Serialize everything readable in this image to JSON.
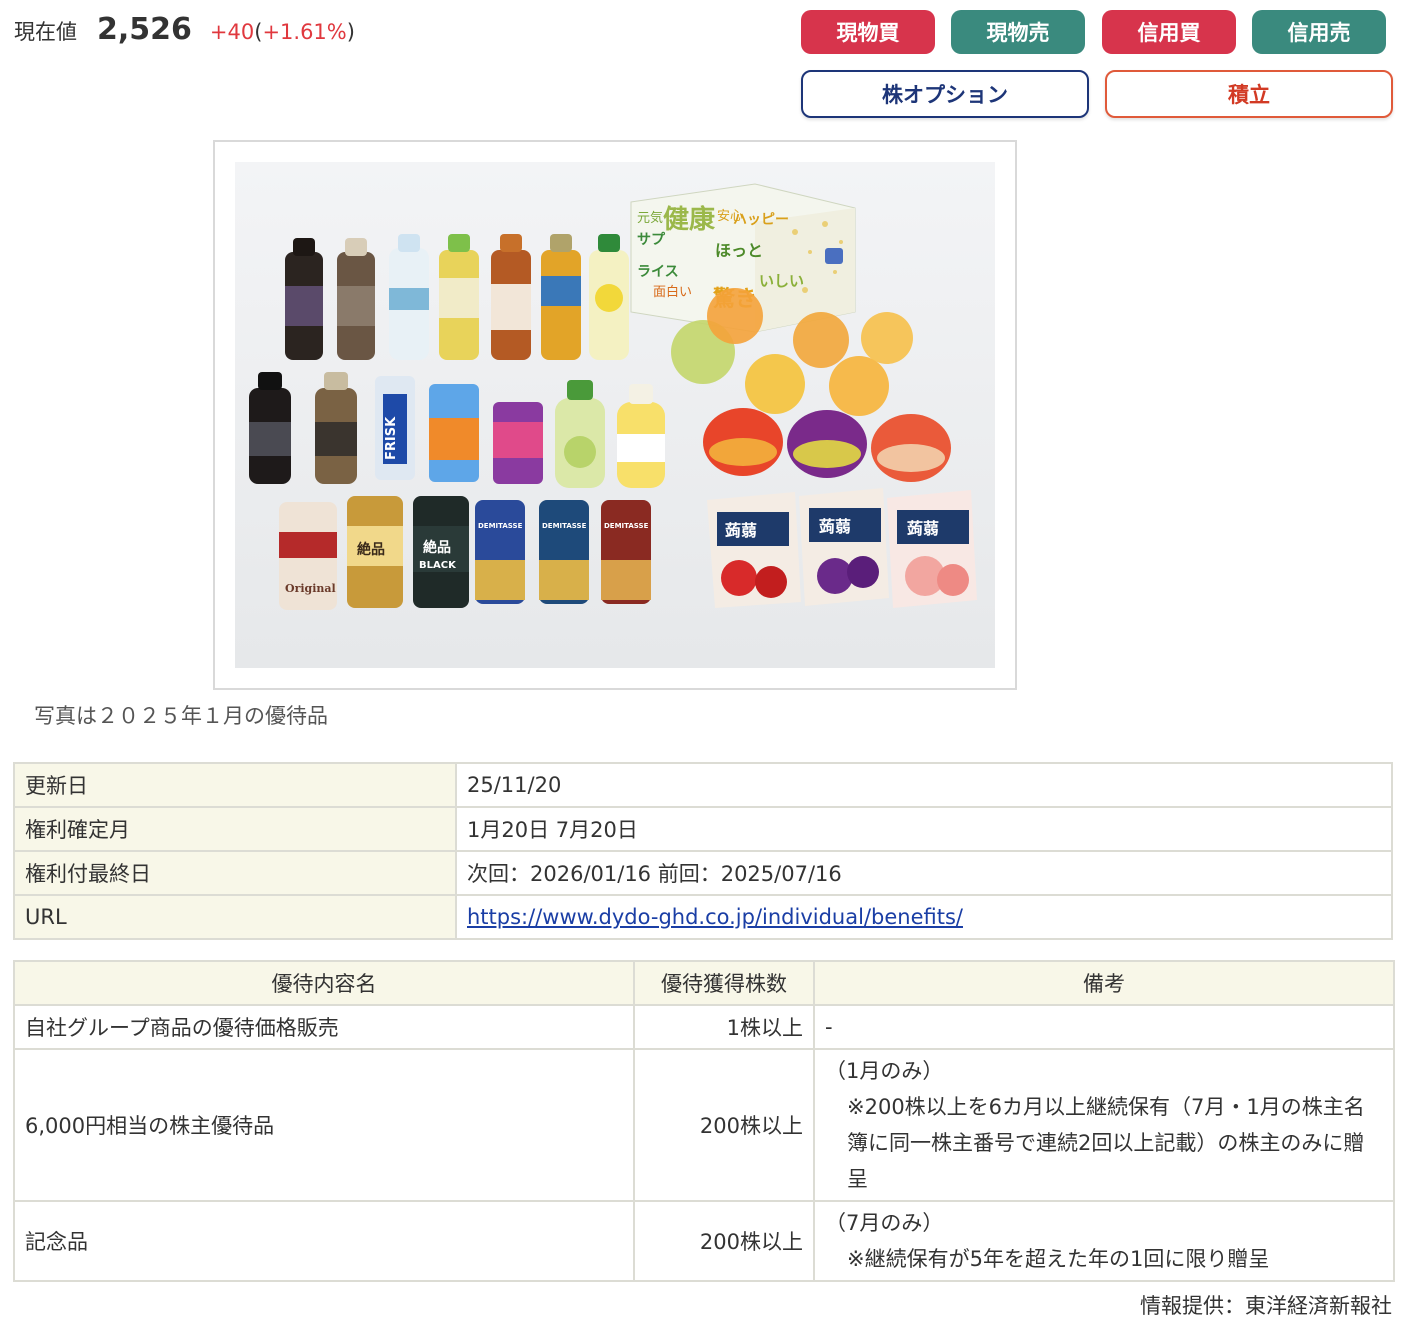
{
  "price": {
    "label": "現在値",
    "value": "2,526",
    "change": "+40",
    "paren_open": " (",
    "change_pct": "+1.61%",
    "paren_close": ")"
  },
  "buttons": {
    "genbutsu_buy": "現物買",
    "genbutsu_sell": "現物売",
    "shinyo_buy": "信用買",
    "shinyo_sell": "信用売",
    "option": "株オプション",
    "tsumitate": "積立"
  },
  "colors": {
    "buy": "#d7344c",
    "sell": "#3a8a7e",
    "option": "#1d3578",
    "tsumitate": "#d23a24",
    "up": "#e0383e"
  },
  "photo": {
    "box_text_1": "元気",
    "box_text_2": "健康",
    "box_text_3": "ハッピー",
    "box_text_4": "安心",
    "box_text_5": "ほっと",
    "box_text_6": "サプ",
    "box_text_7": "ライス",
    "box_text_8": "驚き",
    "box_text_9": "いしい",
    "box_text_10": "面白い",
    "can_text_1": "FRISK",
    "can_text_2": "絶品",
    "can_text_3": "BLACK",
    "can_text_4": "DEMITASSE",
    "can_text_5": "Original",
    "jelly_text": "蒟蒻"
  },
  "caption": "写真は２０２５年１月の優待品",
  "info": {
    "rows": [
      {
        "key": "更新日",
        "value": "25/11/20"
      },
      {
        "key": "権利確定月",
        "value": "1月20日 7月20日"
      },
      {
        "key": "権利付最終日",
        "value": "次回：2026/01/16 前回：2025/07/16"
      },
      {
        "key": "URL",
        "value": "https://www.dydo-ghd.co.jp/individual/benefits/"
      }
    ]
  },
  "benefits": {
    "headers": {
      "name": "優待内容名",
      "shares": "優待獲得株数",
      "note": "備考"
    },
    "rows": [
      {
        "name": "自社グループ商品の優待価格販売",
        "shares": "1株以上",
        "note_head": "-",
        "note_body": ""
      },
      {
        "name": "6,000円相当の株主優待品",
        "shares": "200株以上",
        "note_head": "（1月のみ）",
        "note_body": "※200株以上を6カ月以上継続保有（7月・1月の株主名簿に同一株主番号で連続2回以上記載）の株主のみに贈呈"
      },
      {
        "name": "記念品",
        "shares": "200株以上",
        "note_head": "（7月のみ）",
        "note_body": "※継続保有が5年を超えた年の1回に限り贈呈"
      }
    ]
  },
  "source": "情報提供：東洋経済新報社"
}
